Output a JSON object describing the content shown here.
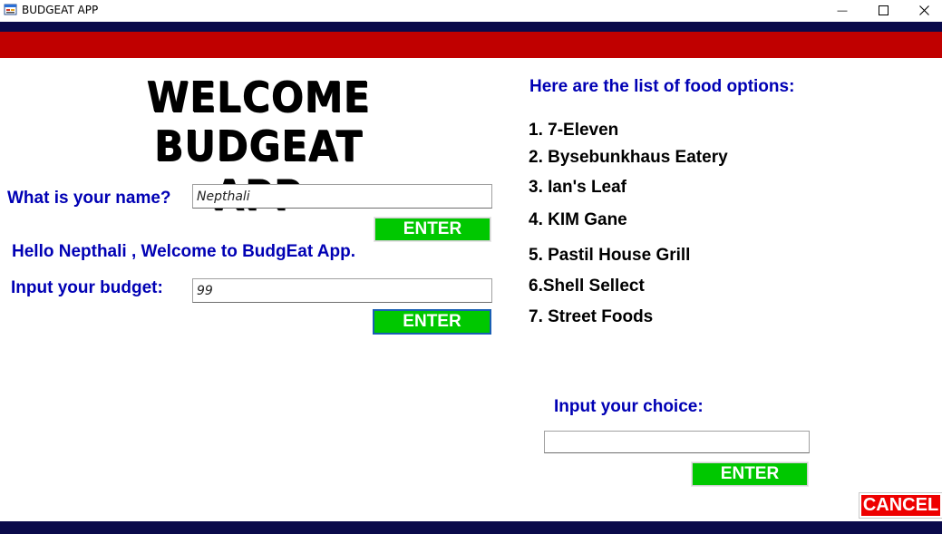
{
  "window": {
    "title": "BUDGEAT APP",
    "icon": "app-form-icon",
    "controls": {
      "minimize": "—",
      "maximize": "☐",
      "close": "✕"
    }
  },
  "welcome": {
    "line1": "WELCOME",
    "line2": "BUDGEAT APP"
  },
  "name_section": {
    "label": "What is your name?",
    "input_value": "Nepthali",
    "enter_label": "ENTER"
  },
  "greeting": "Hello Nepthali , Welcome to BudgEat App.",
  "budget_section": {
    "label": "Input your budget:",
    "input_value": "99",
    "enter_label": "ENTER"
  },
  "food_options": {
    "heading": "Here are the list of food options:",
    "items": [
      "1. 7-Eleven",
      "2. Bysebunkhaus Eatery",
      "3. Ian's Leaf",
      "4. KIM Gane",
      "5. Pastil House  Grill",
      "6.Shell Sellect",
      "7. Street Foods"
    ]
  },
  "choice_section": {
    "label": "Input your choice:",
    "input_value": "",
    "enter_label": "ENTER"
  },
  "cancel_label": "CANCEL",
  "colors": {
    "accent_red": "#c00000",
    "navy": "#0a0a4a",
    "label_blue": "#0000b4",
    "button_green": "#00c800",
    "cancel_red": "#ee0000"
  }
}
